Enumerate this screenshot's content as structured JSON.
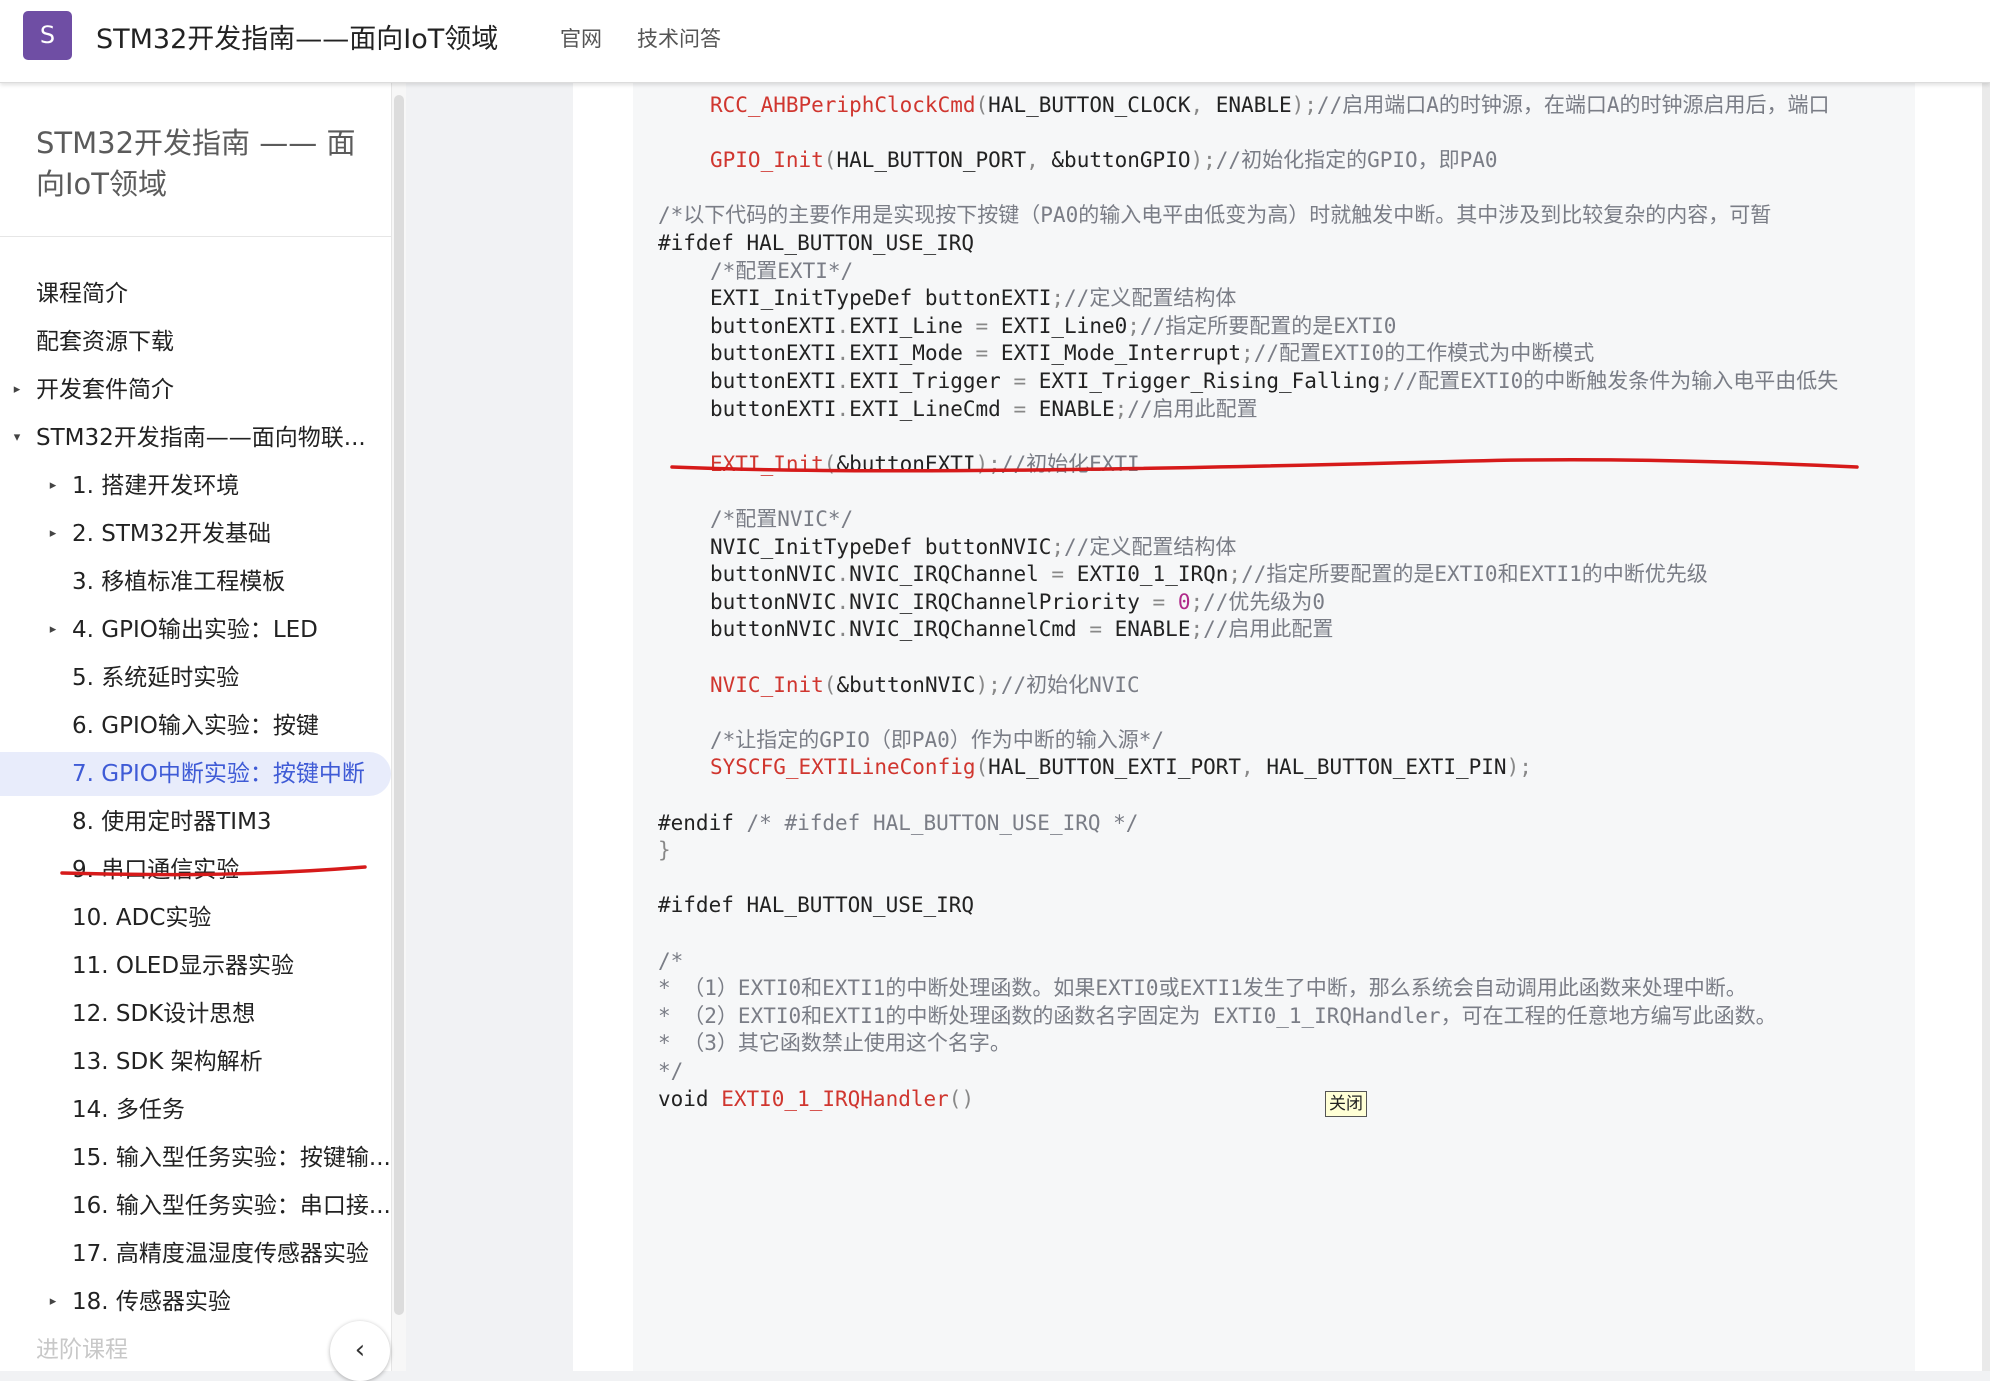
{
  "header": {
    "logo_letter": "S",
    "title": "STM32开发指南——面向IoT领域",
    "nav": [
      "官网",
      "技术问答"
    ]
  },
  "sidebar": {
    "title": "STM32开发指南 —— 面向IoT领域",
    "items": [
      {
        "label": "课程简介",
        "caret": "",
        "level": 0
      },
      {
        "label": "配套资源下载",
        "caret": "",
        "level": 0
      },
      {
        "label": "开发套件简介",
        "caret": "▸",
        "level": 0
      },
      {
        "label": "STM32开发指南——面向物联...",
        "caret": "▾",
        "level": 0
      },
      {
        "label": "1. 搭建开发环境",
        "caret": "▸",
        "level": 1
      },
      {
        "label": "2. STM32开发基础",
        "caret": "▸",
        "level": 1
      },
      {
        "label": "3. 移植标准工程模板",
        "caret": "",
        "level": 1
      },
      {
        "label": "4. GPIO输出实验：LED",
        "caret": "▸",
        "level": 1
      },
      {
        "label": "5. 系统延时实验",
        "caret": "",
        "level": 1
      },
      {
        "label": "6. GPIO输入实验：按键",
        "caret": "",
        "level": 1
      },
      {
        "label": "7. GPIO中断实验：按键中断",
        "caret": "",
        "level": 1,
        "active": true
      },
      {
        "label": "8. 使用定时器TIM3",
        "caret": "",
        "level": 1
      },
      {
        "label": "9. 串口通信实验",
        "caret": "",
        "level": 1
      },
      {
        "label": "10. ADC实验",
        "caret": "",
        "level": 1
      },
      {
        "label": "11. OLED显示器实验",
        "caret": "",
        "level": 1
      },
      {
        "label": "12. SDK设计思想",
        "caret": "",
        "level": 1
      },
      {
        "label": "13. SDK 架构解析",
        "caret": "",
        "level": 1
      },
      {
        "label": "14. 多任务",
        "caret": "",
        "level": 1
      },
      {
        "label": "15. 输入型任务实验：按键输...",
        "caret": "",
        "level": 1
      },
      {
        "label": "16. 输入型任务实验：串口接...",
        "caret": "",
        "level": 1
      },
      {
        "label": "17. 高精度温湿度传感器实验",
        "caret": "",
        "level": 1
      },
      {
        "label": "18. 传感器实验",
        "caret": "▸",
        "level": 1
      },
      {
        "label": "进阶课程",
        "caret": "",
        "level": 0,
        "faded": true
      }
    ],
    "collapse_glyph": "‹"
  },
  "tooltip": {
    "label": "关闭"
  },
  "code_lines": [
    {
      "indent": 2,
      "spans": [
        [
          "fn",
          "RCC_AHBPeriphClockCmd"
        ],
        [
          "punct",
          "("
        ],
        [
          "kw",
          "HAL_BUTTON_CLOCK"
        ],
        [
          "punct",
          ", "
        ],
        [
          "kw",
          "ENABLE"
        ],
        [
          "punct",
          ");"
        ],
        [
          "cm",
          "//启用端口A的时钟源，在端口A的时钟源启用后，端口"
        ]
      ]
    },
    {
      "indent": 0,
      "spans": []
    },
    {
      "indent": 2,
      "spans": [
        [
          "fn",
          "GPIO_Init"
        ],
        [
          "punct",
          "("
        ],
        [
          "kw",
          "HAL_BUTTON_PORT"
        ],
        [
          "punct",
          ", "
        ],
        [
          "kw",
          "&buttonGPIO"
        ],
        [
          "punct",
          ");"
        ],
        [
          "cm",
          "//初始化指定的GPIO，即PA0"
        ]
      ]
    },
    {
      "indent": 0,
      "spans": []
    },
    {
      "indent": 0,
      "spans": [
        [
          "cm",
          "/*以下代码的主要作用是实现按下按键（PA0的输入电平由低变为高）时就触发中断。其中涉及到比较复杂的内容，可暂"
        ]
      ]
    },
    {
      "indent": 0,
      "spans": [
        [
          "kw",
          "#ifdef HAL_BUTTON_USE_IRQ"
        ]
      ]
    },
    {
      "indent": 2,
      "spans": [
        [
          "cm",
          "/*配置EXTI*/"
        ]
      ]
    },
    {
      "indent": 2,
      "spans": [
        [
          "kw",
          "EXTI_InitTypeDef buttonEXTI"
        ],
        [
          "punct",
          ";"
        ],
        [
          "cm",
          "//定义配置结构体"
        ]
      ]
    },
    {
      "indent": 2,
      "spans": [
        [
          "kw",
          "buttonEXTI"
        ],
        [
          "punct",
          "."
        ],
        [
          "kw",
          "EXTI_Line "
        ],
        [
          "punct",
          "= "
        ],
        [
          "kw",
          "EXTI_Line0"
        ],
        [
          "punct",
          ";"
        ],
        [
          "cm",
          "//指定所要配置的是EXTI0"
        ]
      ]
    },
    {
      "indent": 2,
      "spans": [
        [
          "kw",
          "buttonEXTI"
        ],
        [
          "punct",
          "."
        ],
        [
          "kw",
          "EXTI_Mode "
        ],
        [
          "punct",
          "= "
        ],
        [
          "kw",
          "EXTI_Mode_Interrupt"
        ],
        [
          "punct",
          ";"
        ],
        [
          "cm",
          "//配置EXTI0的工作模式为中断模式"
        ]
      ]
    },
    {
      "indent": 2,
      "spans": [
        [
          "kw",
          "buttonEXTI"
        ],
        [
          "punct",
          "."
        ],
        [
          "kw",
          "EXTI_Trigger "
        ],
        [
          "punct",
          "= "
        ],
        [
          "kw",
          "EXTI_Trigger_Rising_Falling"
        ],
        [
          "punct",
          ";"
        ],
        [
          "cm",
          "//配置EXTI0的中断触发条件为输入电平由低失"
        ]
      ]
    },
    {
      "indent": 2,
      "spans": [
        [
          "kw",
          "buttonEXTI"
        ],
        [
          "punct",
          "."
        ],
        [
          "kw",
          "EXTI_LineCmd "
        ],
        [
          "punct",
          "= "
        ],
        [
          "kw",
          "ENABLE"
        ],
        [
          "punct",
          ";"
        ],
        [
          "cm",
          "//启用此配置"
        ]
      ]
    },
    {
      "indent": 0,
      "spans": []
    },
    {
      "indent": 2,
      "spans": [
        [
          "fn",
          "EXTI_Init"
        ],
        [
          "punct",
          "("
        ],
        [
          "kw",
          "&buttonEXTI"
        ],
        [
          "punct",
          ");"
        ],
        [
          "cm",
          "//初始化EXTI"
        ]
      ]
    },
    {
      "indent": 0,
      "spans": []
    },
    {
      "indent": 2,
      "spans": [
        [
          "cm",
          "/*配置NVIC*/"
        ]
      ]
    },
    {
      "indent": 2,
      "spans": [
        [
          "kw",
          "NVIC_InitTypeDef buttonNVIC"
        ],
        [
          "punct",
          ";"
        ],
        [
          "cm",
          "//定义配置结构体"
        ]
      ]
    },
    {
      "indent": 2,
      "spans": [
        [
          "kw",
          "buttonNVIC"
        ],
        [
          "punct",
          "."
        ],
        [
          "kw",
          "NVIC_IRQChannel "
        ],
        [
          "punct",
          "= "
        ],
        [
          "kw",
          "EXTI0_1_IRQn"
        ],
        [
          "punct",
          ";"
        ],
        [
          "cm",
          "//指定所要配置的是EXTI0和EXTI1的中断优先级"
        ]
      ]
    },
    {
      "indent": 2,
      "spans": [
        [
          "kw",
          "buttonNVIC"
        ],
        [
          "punct",
          "."
        ],
        [
          "kw",
          "NVIC_IRQChannelPriority "
        ],
        [
          "punct",
          "= "
        ],
        [
          "num",
          "0"
        ],
        [
          "punct",
          ";"
        ],
        [
          "cm",
          "//优先级为0"
        ]
      ]
    },
    {
      "indent": 2,
      "spans": [
        [
          "kw",
          "buttonNVIC"
        ],
        [
          "punct",
          "."
        ],
        [
          "kw",
          "NVIC_IRQChannelCmd "
        ],
        [
          "punct",
          "= "
        ],
        [
          "kw",
          "ENABLE"
        ],
        [
          "punct",
          ";"
        ],
        [
          "cm",
          "//启用此配置"
        ]
      ]
    },
    {
      "indent": 0,
      "spans": []
    },
    {
      "indent": 2,
      "spans": [
        [
          "fn",
          "NVIC_Init"
        ],
        [
          "punct",
          "("
        ],
        [
          "kw",
          "&buttonNVIC"
        ],
        [
          "punct",
          ");"
        ],
        [
          "cm",
          "//初始化NVIC"
        ]
      ]
    },
    {
      "indent": 0,
      "spans": []
    },
    {
      "indent": 2,
      "spans": [
        [
          "cm",
          "/*让指定的GPIO（即PA0）作为中断的输入源*/"
        ]
      ]
    },
    {
      "indent": 2,
      "spans": [
        [
          "fn",
          "SYSCFG_EXTILineConfig"
        ],
        [
          "punct",
          "("
        ],
        [
          "kw",
          "HAL_BUTTON_EXTI_PORT"
        ],
        [
          "punct",
          ", "
        ],
        [
          "kw",
          "HAL_BUTTON_EXTI_PIN"
        ],
        [
          "punct",
          ");"
        ]
      ]
    },
    {
      "indent": 0,
      "spans": []
    },
    {
      "indent": 0,
      "spans": [
        [
          "kw",
          "#endif "
        ],
        [
          "cm",
          "/* #ifdef HAL_BUTTON_USE_IRQ */"
        ]
      ]
    },
    {
      "indent": 0,
      "spans": [
        [
          "punct",
          "}"
        ]
      ]
    },
    {
      "indent": 0,
      "spans": []
    },
    {
      "indent": 0,
      "spans": [
        [
          "kw",
          "#ifdef HAL_BUTTON_USE_IRQ"
        ]
      ]
    },
    {
      "indent": 0,
      "spans": []
    },
    {
      "indent": 0,
      "spans": [
        [
          "cm",
          "/*"
        ]
      ]
    },
    {
      "indent": 0,
      "spans": [
        [
          "cm",
          "* （1）EXTI0和EXTI1的中断处理函数。如果EXTI0或EXTI1发生了中断，那么系统会自动调用此函数来处理中断。"
        ]
      ]
    },
    {
      "indent": 0,
      "spans": [
        [
          "cm",
          "* （2）EXTI0和EXTI1的中断处理函数的函数名字固定为 EXTI0_1_IRQHandler，可在工程的任意地方编写此函数。"
        ]
      ]
    },
    {
      "indent": 0,
      "spans": [
        [
          "cm",
          "* （3）其它函数禁止使用这个名字。"
        ]
      ]
    },
    {
      "indent": 0,
      "spans": [
        [
          "cm",
          "*/"
        ]
      ]
    },
    {
      "indent": 0,
      "spans": [
        [
          "kw",
          "void "
        ],
        [
          "fn",
          "EXTI0_1_IRQHandler"
        ],
        [
          "punct",
          "()"
        ]
      ]
    }
  ]
}
